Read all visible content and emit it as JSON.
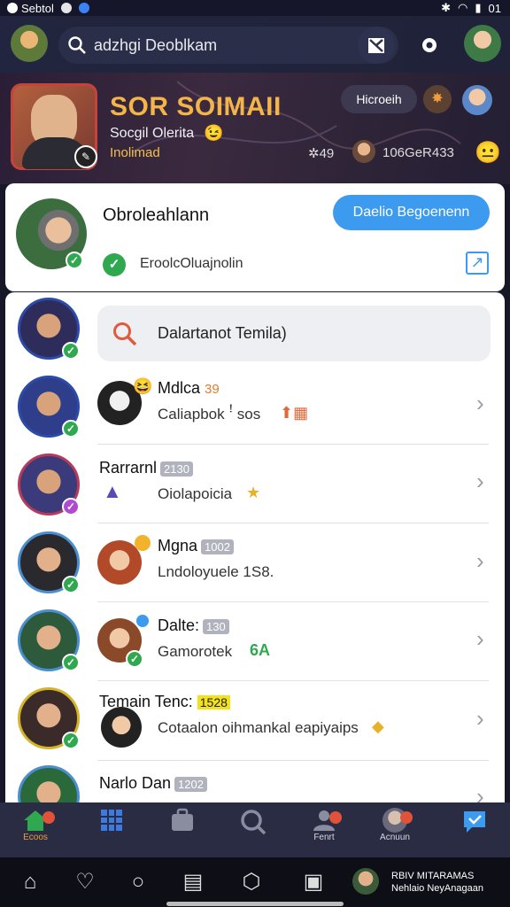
{
  "status_bar": {
    "carrier": "Sebtol",
    "time": "01"
  },
  "header": {
    "search_text": "adzhgi Deoblkam"
  },
  "banner": {
    "title": "SOR SOIMAII",
    "subtitle": "Socgil Olerita",
    "tag": "Inolimad",
    "chip_label": "Hicroeih",
    "stat_a": "49",
    "stat_b": "106GeR433"
  },
  "card": {
    "name": "Obroleahlann",
    "button_label": "Daelio Begoenenn",
    "status_text": "EroolcOluajnolin"
  },
  "list": {
    "search_placeholder": "Dalartanot Temila)",
    "items": [
      {
        "name": "Mdlca",
        "badge": "39",
        "subtitle": "Caliapbok ꜝ sos"
      },
      {
        "name": "Rarrarnl",
        "badge": "2130",
        "subtitle": "Oiolapoicia"
      },
      {
        "name": "Mgna",
        "badge": "1002",
        "subtitle": "Lndoloyuele 1S8."
      },
      {
        "name": "Dalte:",
        "badge": "130",
        "subtitle": "Gamorotek"
      },
      {
        "name": "Temain Tenc:",
        "badge": "1528",
        "subtitle": "Cotaalon oihmankal eapiyaips"
      },
      {
        "name": "Narlo Dan",
        "badge": "1202",
        "subtitle": ""
      }
    ],
    "item5_extra": "6A"
  },
  "bottom_nav": {
    "home_label": "Ecoos",
    "friends_label": "Fenrt",
    "account_label": "Acnuun"
  },
  "system_nav": {
    "user_line1": "RBIV MITARAMAS",
    "user_line2": "Nehlaio NeyAnagaan"
  },
  "colors": {
    "accent": "#3d9bef",
    "banner_title": "#f3b54a",
    "online": "#2fa84f",
    "nav_bg": "#2a2c44"
  }
}
